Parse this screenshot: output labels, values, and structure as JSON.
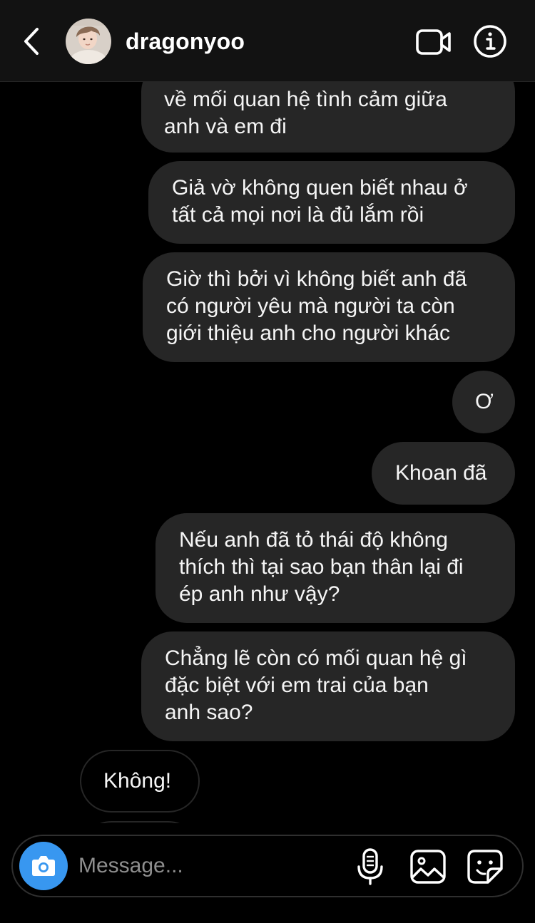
{
  "header": {
    "username": "dragonyoo",
    "back_icon": "chevron-left-icon",
    "video_icon": "video-camera-icon",
    "info_icon": "info-icon"
  },
  "messages": [
    {
      "sender": "me",
      "text": "về mối quan hệ tình cảm giữa\nanh và em đi"
    },
    {
      "sender": "me",
      "text": "Giả vờ không quen biết nhau ở\ntất cả mọi nơi là đủ lắm rồi"
    },
    {
      "sender": "me",
      "text": "Giờ thì bởi vì không biết anh đã\ncó người yêu mà người ta còn\ngiới thiệu anh cho người khác"
    },
    {
      "sender": "me",
      "text": "Ơ"
    },
    {
      "sender": "me",
      "text": "Khoan đã"
    },
    {
      "sender": "me",
      "text": "Nếu anh đã tỏ thái độ không\nthích thì tại sao bạn thân lại đi\nép anh như vậy?"
    },
    {
      "sender": "me",
      "text": "Chẳng lẽ còn có mối quan hệ gì\nđặc biệt với em trai của bạn\nanh sao?"
    },
    {
      "sender": "them",
      "text": "Không!"
    }
  ],
  "composer": {
    "placeholder": "Message...",
    "value": "",
    "camera_icon": "camera-icon",
    "mic_icon": "microphone-icon",
    "gallery_icon": "image-icon",
    "sticker_icon": "sticker-icon"
  },
  "colors": {
    "background": "#000000",
    "header": "#121212",
    "outgoing_bubble": "#262626",
    "incoming_border": "#262626",
    "accent": "#3897f0",
    "placeholder": "#8e8e8e"
  }
}
